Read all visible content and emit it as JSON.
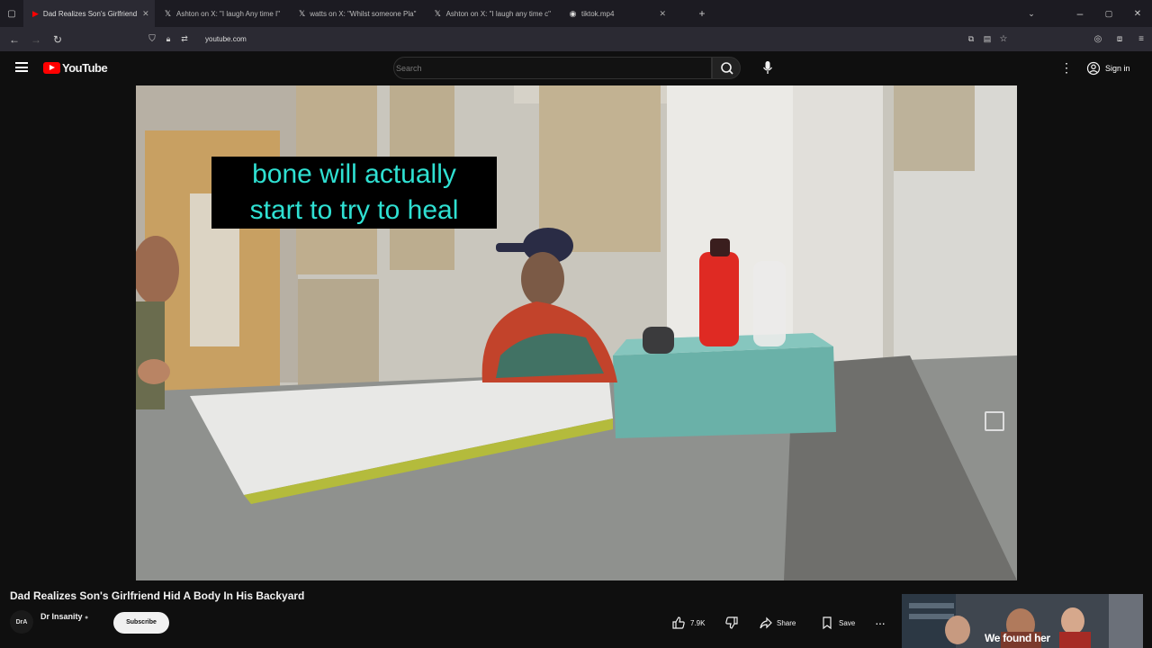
{
  "browser": {
    "tabs": [
      {
        "label": "Dad Realizes Son's Girlfriend",
        "icon": "youtube-favicon",
        "active": true
      },
      {
        "label": "Ashton on X: \"I laugh Any time I\"",
        "icon": "x-favicon"
      },
      {
        "label": "watts on X: \"Whilst someone Pla\"",
        "icon": "x-favicon"
      },
      {
        "label": "Ashton on X: \"I laugh any time c\"",
        "icon": "x-favicon"
      },
      {
        "label": "tiktok.mp4",
        "icon": "page-favicon"
      }
    ],
    "url": "youtube.com"
  },
  "youtube": {
    "logo_text": "YouTube",
    "search_placeholder": "Search",
    "sign_in": "Sign in"
  },
  "video": {
    "caption_line1": "bone will actually",
    "caption_line2": "start to try to heal",
    "title": "Dad Realizes Son's Girlfriend Hid A Body In His Backyard",
    "channel": "Dr Insanity",
    "avatar_text": "DrA",
    "subscribe_label": "Subscribe",
    "likes": "7.9K",
    "share_label": "Share",
    "save_label": "Save"
  },
  "recommended": {
    "thumb_text": "We found her"
  }
}
